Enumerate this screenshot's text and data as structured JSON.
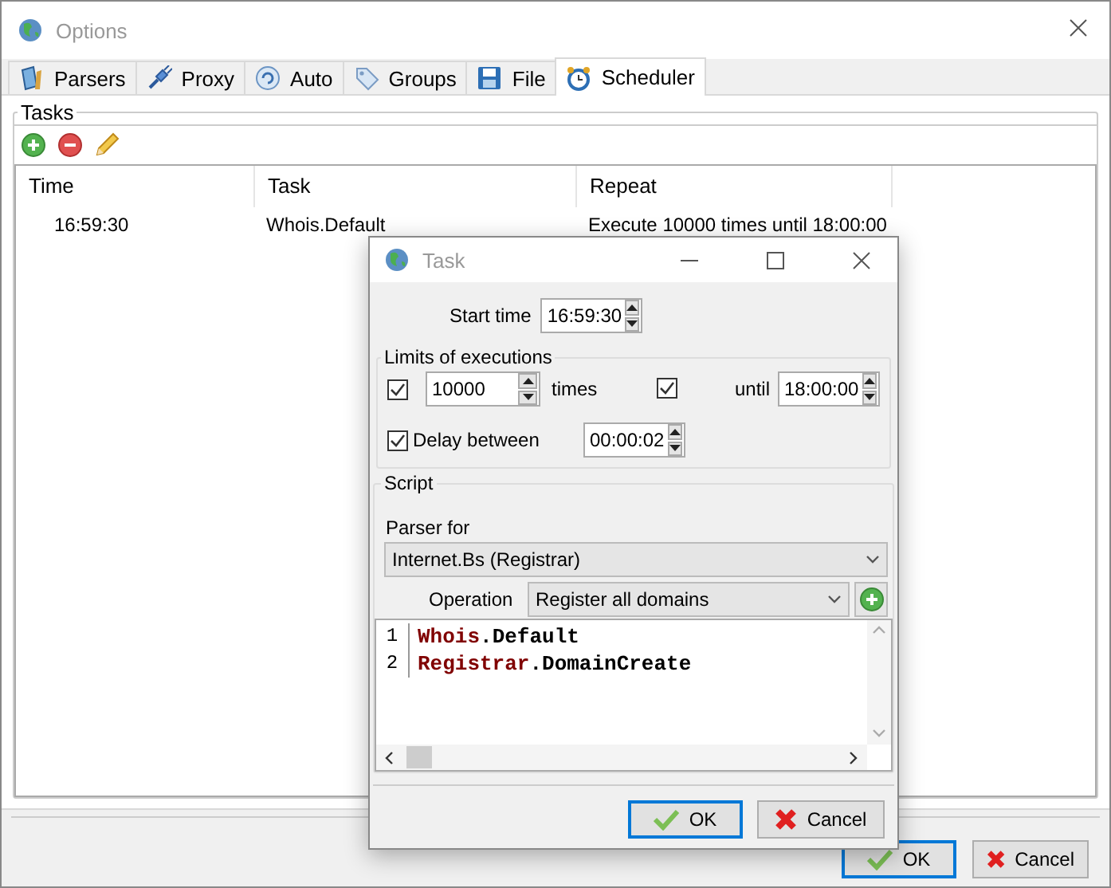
{
  "window": {
    "title": "Options"
  },
  "tabs": [
    {
      "label": "Parsers",
      "selected": false
    },
    {
      "label": "Proxy",
      "selected": false
    },
    {
      "label": "Auto",
      "selected": false
    },
    {
      "label": "Groups",
      "selected": false
    },
    {
      "label": "File",
      "selected": false
    },
    {
      "label": "Scheduler",
      "selected": true
    }
  ],
  "tasks_group": {
    "title": "Tasks"
  },
  "table": {
    "columns": [
      "Time",
      "Task",
      "Repeat"
    ],
    "rows": [
      [
        "16:59:30",
        "Whois.Default",
        "Execute 10000 times until 18:00:00"
      ]
    ]
  },
  "buttons": [
    {
      "label": "OK",
      "default": true
    },
    {
      "label": "Cancel",
      "default": false
    }
  ],
  "task_dialog": {
    "title": "Task",
    "start_time": {
      "label": "Start time",
      "value": "16:59:30"
    },
    "limits": {
      "title": "Limits of executions",
      "times": {
        "checked": true,
        "value": "10000",
        "label": "times"
      },
      "until": {
        "checked": true,
        "label": "until",
        "value": "18:00:00"
      },
      "delay": {
        "checked": true,
        "label": "Delay between",
        "value": "00:00:02"
      }
    },
    "script": {
      "title": "Script",
      "parser_label": "Parser for",
      "parser": "Internet.Bs (Registrar)",
      "operation_label": "Operation",
      "operation": "Register all domains",
      "lines": [
        {
          "number": "1",
          "tokens": [
            {
              "kind": "object",
              "text": "Whois"
            },
            {
              "kind": "plain",
              "text": ".Default"
            }
          ]
        },
        {
          "number": "2",
          "tokens": [
            {
              "kind": "object",
              "text": "Registrar"
            },
            {
              "kind": "plain",
              "text": ".DomainCreate"
            }
          ]
        }
      ]
    },
    "buttons": [
      {
        "label": "OK",
        "default": true
      },
      {
        "label": "Cancel",
        "default": false
      }
    ]
  }
}
